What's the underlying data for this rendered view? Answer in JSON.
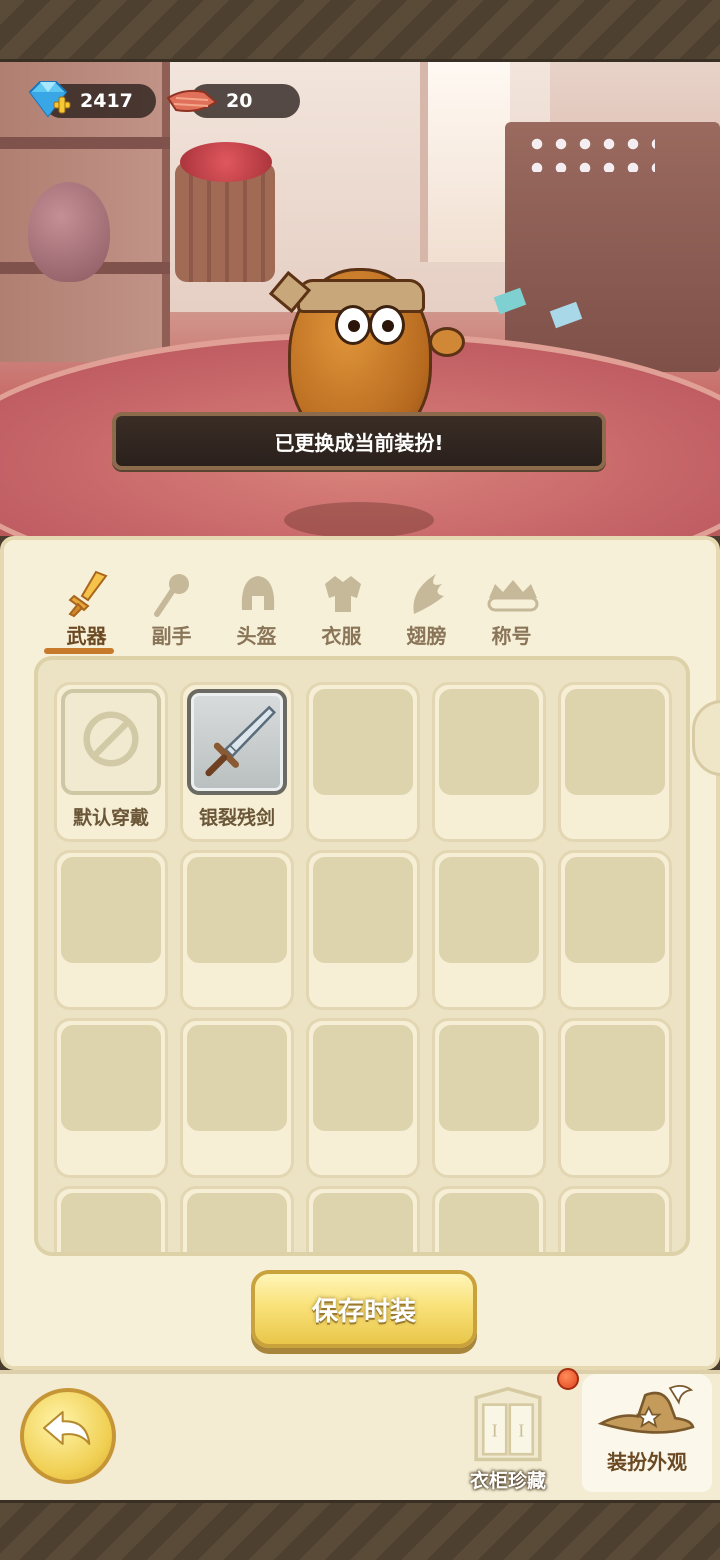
{
  "currencies": {
    "gems": "2417",
    "cloth": "20"
  },
  "toast": "已更换成当前装扮!",
  "tabs": [
    {
      "label": "武器",
      "icon": "sword-icon",
      "active": true
    },
    {
      "label": "副手",
      "icon": "offhand-icon",
      "active": false
    },
    {
      "label": "头盔",
      "icon": "helmet-icon",
      "active": false
    },
    {
      "label": "衣服",
      "icon": "armor-icon",
      "active": false
    },
    {
      "label": "翅膀",
      "icon": "wings-icon",
      "active": false
    },
    {
      "label": "称号",
      "icon": "title-icon",
      "active": false
    }
  ],
  "items": [
    {
      "label": "默认穿戴",
      "icon": "none-icon"
    },
    {
      "label": "银裂残剑",
      "icon": "silver-sword-icon"
    }
  ],
  "save_button": "保存时装",
  "bottom": {
    "wardrobe_label": "衣柜珍藏",
    "appearance_label": "装扮外观"
  },
  "colors": {
    "accent": "#c87a2c",
    "button_yellow": "#f9e27a",
    "panel": "#f7f0d9"
  }
}
